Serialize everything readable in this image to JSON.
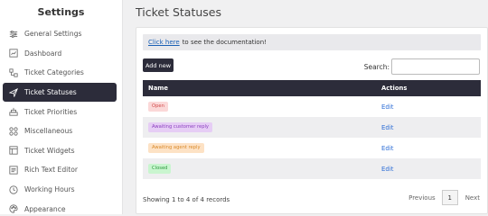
{
  "sidebar": {
    "title": "Settings",
    "items": [
      {
        "label": "General Settings",
        "icon": "sliders-icon"
      },
      {
        "label": "Dashboard",
        "icon": "dashboard-icon"
      },
      {
        "label": "Ticket Categories",
        "icon": "categories-icon"
      },
      {
        "label": "Ticket Statuses",
        "icon": "send-icon"
      },
      {
        "label": "Ticket Priorities",
        "icon": "priorities-icon"
      },
      {
        "label": "Miscellaneous",
        "icon": "puzzle-icon"
      },
      {
        "label": "Ticket Widgets",
        "icon": "widgets-icon"
      },
      {
        "label": "Rich Text Editor",
        "icon": "editor-icon"
      },
      {
        "label": "Working Hours",
        "icon": "clock-icon"
      },
      {
        "label": "Appearance",
        "icon": "palette-icon"
      }
    ],
    "active_index": 3
  },
  "main": {
    "title": "Ticket Statuses",
    "notice": {
      "link_text": "Click here",
      "text": "to see the documentation!"
    },
    "add_button": "Add new",
    "search_label": "Search:",
    "search_value": "",
    "table": {
      "columns": [
        "Name",
        "Actions"
      ],
      "rows": [
        {
          "name": "Open",
          "bg": "#fbd8d8",
          "fg": "#d14a4a",
          "action": "Edit"
        },
        {
          "name": "Awaiting customer reply",
          "bg": "#e6cdf5",
          "fg": "#8b3fbf",
          "action": "Edit"
        },
        {
          "name": "Awaiting agent reply",
          "bg": "#fde2c5",
          "fg": "#d98a2b",
          "action": "Edit"
        },
        {
          "name": "Closed",
          "bg": "#c9f5cf",
          "fg": "#2e9a3f",
          "action": "Edit"
        }
      ]
    },
    "footer_info": "Showing 1 to 4 of 4 records",
    "pager": {
      "prev": "Previous",
      "page": "1",
      "next": "Next"
    }
  },
  "colors": {
    "dark": "#2c2c3a",
    "link": "#2f6fd6"
  }
}
